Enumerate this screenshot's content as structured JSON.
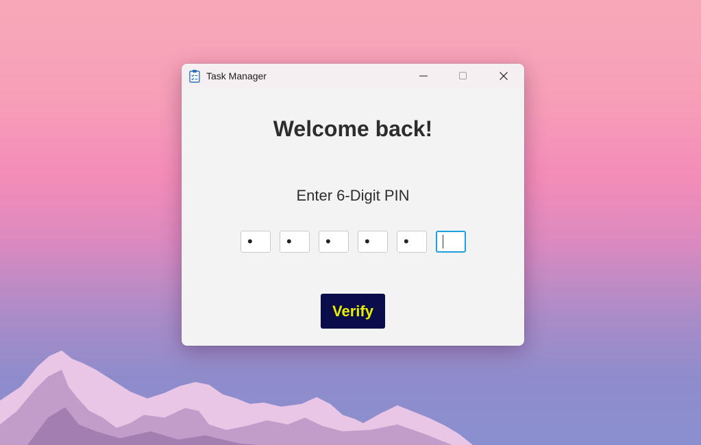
{
  "window": {
    "title": "Task Manager",
    "app_icon": "clipboard-checklist-icon"
  },
  "titlebar_buttons": {
    "minimize_icon": "minimize-icon",
    "maximize_icon": "maximize-icon",
    "close_icon": "close-icon"
  },
  "main": {
    "heading": "Welcome back!",
    "pin_label": "Enter 6-Digit PIN",
    "pin_digits": [
      "•",
      "•",
      "•",
      "•",
      "•",
      ""
    ],
    "active_pin_index": 5,
    "verify_label": "Verify"
  },
  "colors": {
    "verify_bg": "#0b0c4a",
    "verify_text": "#e8f000",
    "focus_border": "#1a9fe0"
  }
}
